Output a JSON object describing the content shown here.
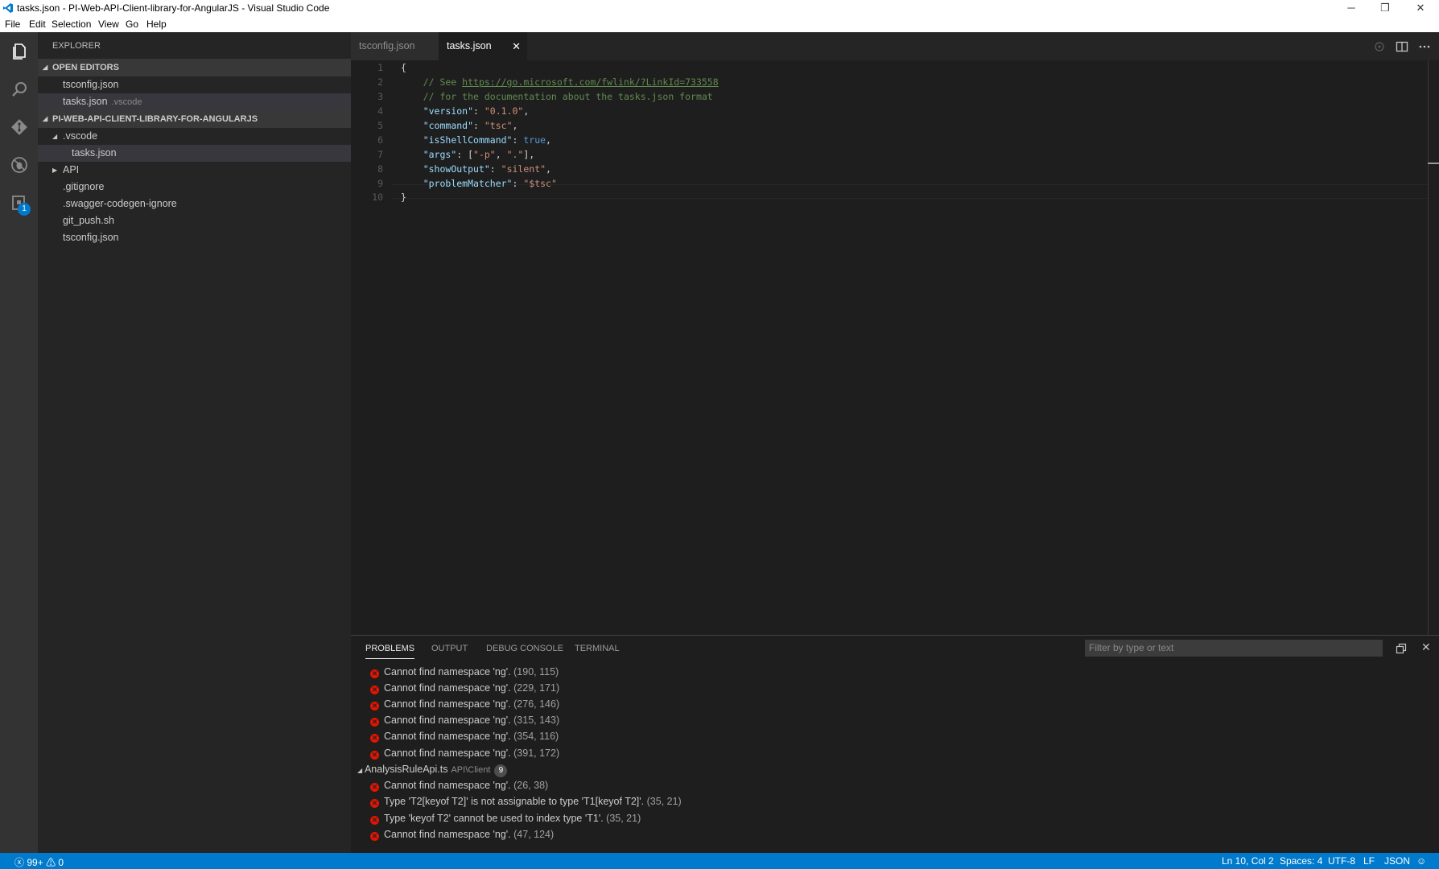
{
  "window": {
    "title": "tasks.json - PI-Web-API-Client-library-for-AngularJS - Visual Studio Code",
    "controls": {
      "minimize": "─",
      "restore": "❐",
      "close": "✕"
    }
  },
  "menu": [
    "File",
    "Edit",
    "Selection",
    "View",
    "Go",
    "Help"
  ],
  "activity": {
    "icons": [
      "files-icon",
      "search-icon",
      "git-icon",
      "debug-icon",
      "extensions-icon"
    ],
    "extensions_badge": "1"
  },
  "sidebar": {
    "title": "EXPLORER",
    "open_editors_label": "OPEN EDITORS",
    "open_editors": [
      {
        "name": "tsconfig.json",
        "desc": ""
      },
      {
        "name": "tasks.json",
        "desc": ".vscode"
      }
    ],
    "project_label": "PI-WEB-API-CLIENT-LIBRARY-FOR-ANGULARJS",
    "tree": [
      {
        "name": ".vscode"
      },
      {
        "name": "tasks.json"
      },
      {
        "name": "API"
      },
      {
        "name": ".gitignore"
      },
      {
        "name": ".swagger-codegen-ignore"
      },
      {
        "name": "git_push.sh"
      },
      {
        "name": "tsconfig.json"
      }
    ]
  },
  "tabs": [
    {
      "label": "tsconfig.json"
    },
    {
      "label": "tasks.json",
      "close": "✕"
    }
  ],
  "editor": {
    "line_numbers": [
      "1",
      "2",
      "3",
      "4",
      "5",
      "6",
      "7",
      "8",
      "9",
      "10"
    ],
    "lines": {
      "l1": "{",
      "l2_comment": "    // See ",
      "l2_link": "https://go.microsoft.com/fwlink/?LinkId=733558",
      "l3": "    // for the documentation about the tasks.json format",
      "l4_key": "\"version\"",
      "l4_val": "\"0.1.0\"",
      "l5_key": "\"command\"",
      "l5_val": "\"tsc\"",
      "l6_key": "\"isShellCommand\"",
      "l6_val": "true",
      "l7_key": "\"args\"",
      "l7_v1": "\"-p\"",
      "l7_v2": "\".\"",
      "l8_key": "\"showOutput\"",
      "l8_val": "\"silent\"",
      "l9_key": "\"problemMatcher\"",
      "l9_val": "\"$tsc\"",
      "l10": "}"
    }
  },
  "panel": {
    "tabs": [
      "PROBLEMS",
      "OUTPUT",
      "DEBUG CONSOLE",
      "TERMINAL"
    ],
    "filter_placeholder": "Filter by type or text",
    "problems": [
      {
        "msg": "Cannot find namespace 'ng'.",
        "pos": "(190, 115)"
      },
      {
        "msg": "Cannot find namespace 'ng'.",
        "pos": "(229, 171)"
      },
      {
        "msg": "Cannot find namespace 'ng'.",
        "pos": "(276, 146)"
      },
      {
        "msg": "Cannot find namespace 'ng'.",
        "pos": "(315, 143)"
      },
      {
        "msg": "Cannot find namespace 'ng'.",
        "pos": "(354, 116)"
      },
      {
        "msg": "Cannot find namespace 'ng'.",
        "pos": "(391, 172)"
      }
    ],
    "file_group": {
      "name": "AnalysisRuleApi.ts",
      "path": "API\\Client",
      "count": "9"
    },
    "group_problems": [
      {
        "msg": "Cannot find namespace 'ng'.",
        "pos": "(26, 38)"
      },
      {
        "msg": "Type 'T2[keyof T2]' is not assignable to type 'T1[keyof T2]'.",
        "pos": "(35, 21)"
      },
      {
        "msg": "Type 'keyof T2' cannot be used to index type 'T1'.",
        "pos": "(35, 21)"
      },
      {
        "msg": "Cannot find namespace 'ng'.",
        "pos": "(47, 124)"
      }
    ]
  },
  "status": {
    "errors": "99+",
    "warnings": "0",
    "cursor": "Ln 10, Col 2",
    "spaces": "Spaces: 4",
    "encoding": "UTF-8",
    "eol": "LF",
    "language": "JSON"
  }
}
